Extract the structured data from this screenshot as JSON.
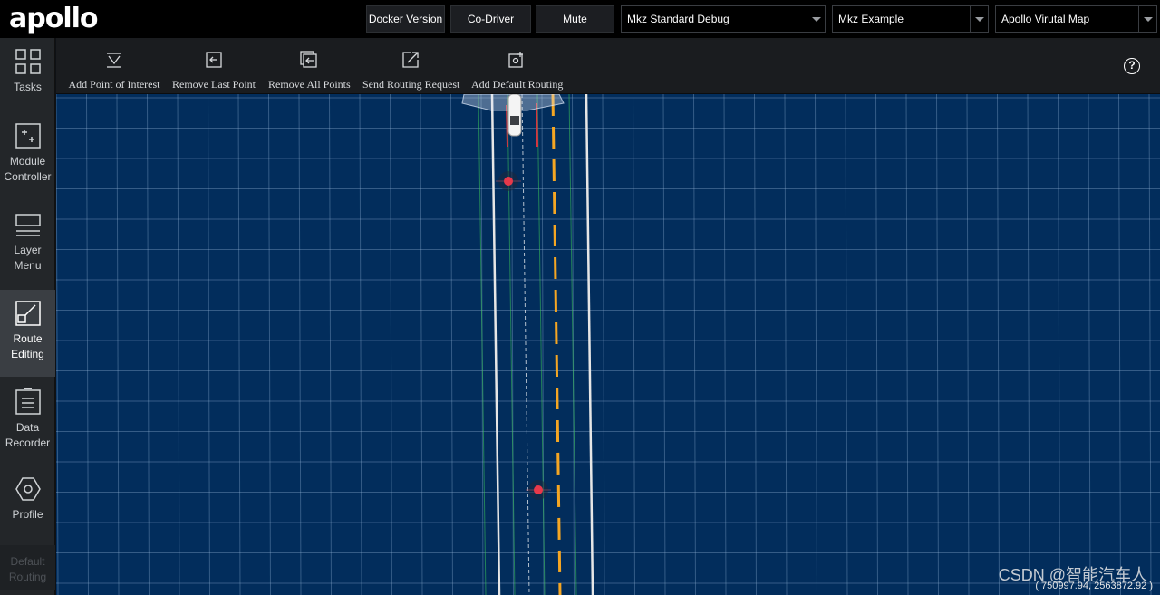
{
  "header": {
    "logo": "apollo",
    "buttons": {
      "docker_version": "Docker Version",
      "co_driver": "Co-Driver",
      "mute": "Mute"
    },
    "selects": {
      "mode": "Mkz Standard Debug",
      "vehicle": "Mkz Example",
      "map": "Apollo Virutal Map"
    }
  },
  "sidebar": {
    "items": [
      {
        "label_line1": "Tasks",
        "label_line2": "",
        "icon": "grid-icon"
      },
      {
        "label_line1": "Module",
        "label_line2": "Controller",
        "icon": "module-controller-icon"
      },
      {
        "label_line1": "Layer",
        "label_line2": "Menu",
        "icon": "layer-menu-icon"
      },
      {
        "label_line1": "Route",
        "label_line2": "Editing",
        "icon": "route-editing-icon"
      },
      {
        "label_line1": "Data",
        "label_line2": "Recorder",
        "icon": "data-recorder-icon"
      },
      {
        "label_line1": "Profile",
        "label_line2": "",
        "icon": "hexagon-icon"
      },
      {
        "label_line1": "Default",
        "label_line2": "Routing",
        "icon": ""
      }
    ]
  },
  "toolbar": {
    "add_poi": "Add Point of Interest",
    "remove_last": "Remove Last Point",
    "remove_all": "Remove All Points",
    "send_routing": "Send Routing Request",
    "add_default": "Add Default Routing",
    "help": "?"
  },
  "map": {
    "coordinates": "( 750997.94, 2563872.92 )",
    "background_color": "#022d5c",
    "lane_center_color": "#f5a623",
    "route_point_color": "#e8394a"
  },
  "watermark": "CSDN @智能汽车人"
}
